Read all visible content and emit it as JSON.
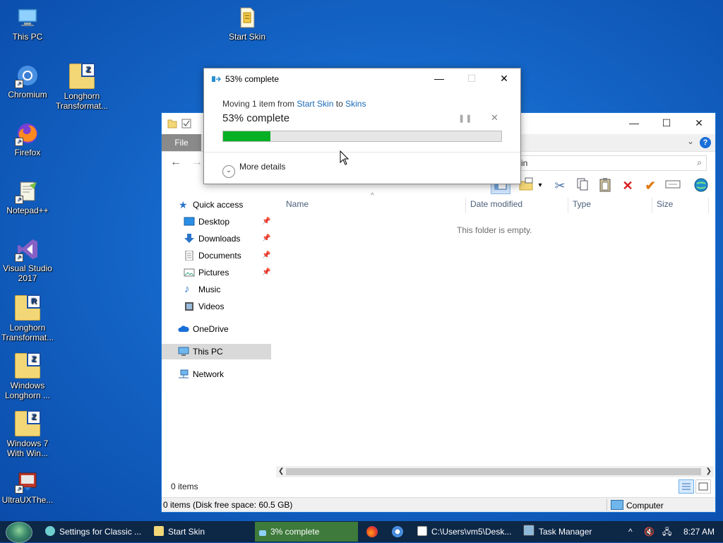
{
  "desktop": {
    "icons": [
      {
        "label": "This PC"
      },
      {
        "label": "Start Skin"
      },
      {
        "label": "Chromium"
      },
      {
        "label": "Longhorn Transformat..."
      },
      {
        "label": "Firefox"
      },
      {
        "label": "Notepad++"
      },
      {
        "label": "Visual Studio 2017"
      },
      {
        "label": "Longhorn Transformat..."
      },
      {
        "label": "Windows Longhorn ..."
      },
      {
        "label": "Windows 7 With Win..."
      },
      {
        "label": "UltraUXThe..."
      }
    ]
  },
  "explorer": {
    "ribbon": {
      "file_tab": "File",
      "help": "?"
    },
    "search": {
      "value": "kin",
      "icon": "search-icon"
    },
    "nav": {
      "quick_access": "Quick access",
      "desktop": "Desktop",
      "downloads": "Downloads",
      "documents": "Documents",
      "pictures": "Pictures",
      "music": "Music",
      "videos": "Videos",
      "onedrive": "OneDrive",
      "this_pc": "This PC",
      "network": "Network"
    },
    "columns": {
      "name": "Name",
      "date_modified": "Date modified",
      "type": "Type",
      "size": "Size"
    },
    "empty_message": "This folder is empty.",
    "item_count": "0 items",
    "status_left": "0 items (Disk free space: 60.5 GB)",
    "status_right": "Computer"
  },
  "dialog": {
    "title": "53% complete",
    "moving_prefix": "Moving 1 item from ",
    "source": "Start Skin",
    "to_word": " to ",
    "destination": "Skins",
    "percent_text": "53% complete",
    "progress": 0.17,
    "more_details": "More details"
  },
  "taskbar": {
    "buttons": [
      {
        "label": "Settings for Classic ..."
      },
      {
        "label": "Start Skin"
      },
      {
        "label": "3% complete"
      },
      {
        "label": "C:\\Users\\vm5\\Desk..."
      },
      {
        "label": "Task Manager"
      }
    ],
    "clock": "8:27 AM"
  },
  "colors": {
    "progress_fill": "#06b025",
    "link": "#1a6ab8",
    "taskbar": "#0d2747",
    "active_task": "#3d7a3b"
  }
}
